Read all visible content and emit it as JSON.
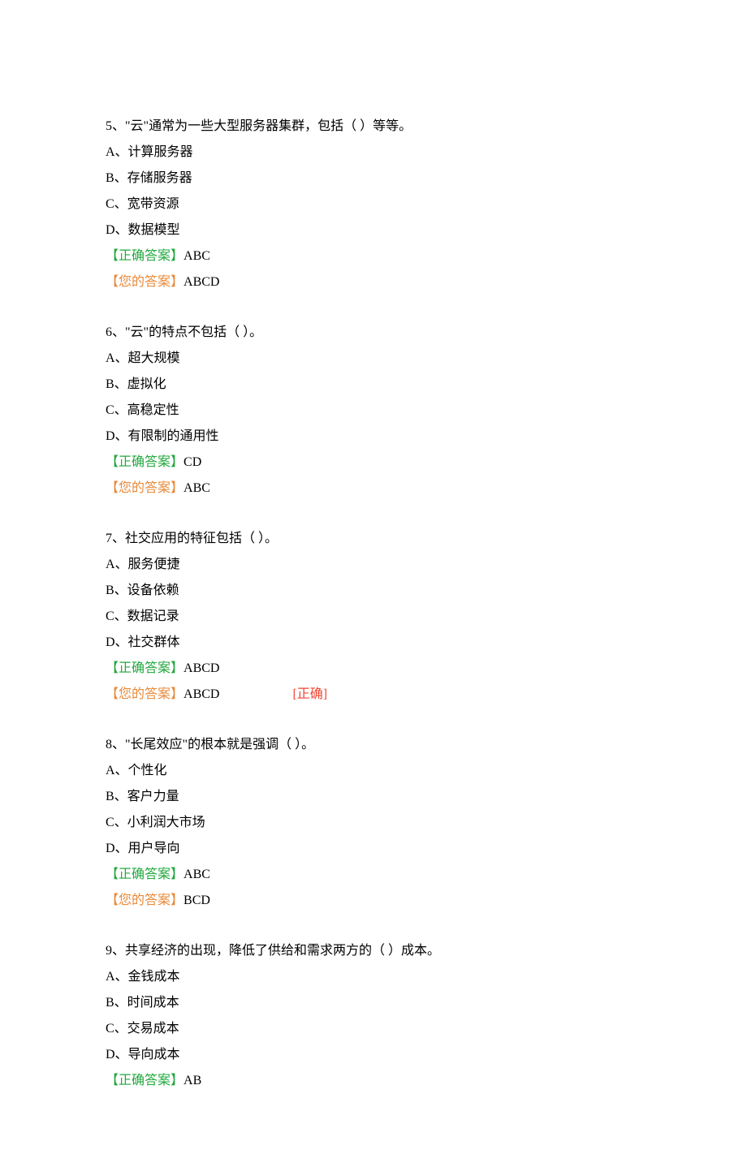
{
  "labels": {
    "correct_answer_label": "【正确答案】",
    "your_answer_label": "【您的答案】",
    "status_correct": "[正确]"
  },
  "questions": [
    {
      "number": "5、",
      "text": "\"云\"通常为一些大型服务器集群，包括（  ）等等。",
      "options": [
        "A、计算服务器",
        "B、存储服务器",
        "C、宽带资源",
        "D、数据模型"
      ],
      "correct_answer": "ABC",
      "your_answer": "ABCD",
      "is_correct": false
    },
    {
      "number": "6、",
      "text": "\"云\"的特点不包括（  ）。",
      "options": [
        "A、超大规模",
        "B、虚拟化",
        "C、高稳定性",
        "D、有限制的通用性"
      ],
      "correct_answer": "CD",
      "your_answer": "ABC",
      "is_correct": false
    },
    {
      "number": "7、",
      "text": "社交应用的特征包括（  ）。",
      "options": [
        "A、服务便捷",
        "B、设备依赖",
        "C、数据记录",
        "D、社交群体"
      ],
      "correct_answer": "ABCD",
      "your_answer": "ABCD",
      "is_correct": true
    },
    {
      "number": "8、",
      "text": "\"长尾效应\"的根本就是强调（  ）。",
      "options": [
        "A、个性化",
        "B、客户力量",
        "C、小利润大市场",
        "D、用户导向"
      ],
      "correct_answer": "ABC",
      "your_answer": "BCD",
      "is_correct": false
    },
    {
      "number": "9、",
      "text": "共享经济的出现，降低了供给和需求两方的（  ）成本。",
      "options": [
        "A、金钱成本",
        "B、时间成本",
        "C、交易成本",
        "D、导向成本"
      ],
      "correct_answer": "AB",
      "your_answer": null,
      "is_correct": false
    }
  ]
}
